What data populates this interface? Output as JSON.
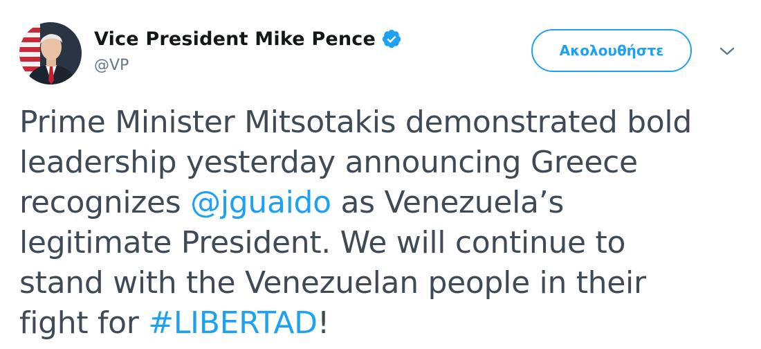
{
  "author": {
    "display_name": "Vice President Mike Pence",
    "handle": "@VP",
    "verified": true,
    "avatar_icon": "profile-photo"
  },
  "actions": {
    "follow_label": "Ακολουθήστε",
    "menu_icon": "chevron-down-icon"
  },
  "colors": {
    "accent": "#1da1f2",
    "text": "#3f4a55",
    "name": "#14171a",
    "handle": "#657786"
  },
  "tweet": {
    "line1": "Prime Minister Mitsotakis demonstrated bold",
    "line2": "leadership yesterday announcing Greece",
    "line3_before": "recognizes ",
    "mention": "@jguaido",
    "line3_after": " as Venezuela’s",
    "line4": "legitimate President. We will continue to",
    "line5": "stand with the Venezuelan people in their",
    "line6_before": "fight for ",
    "hashtag": "#LIBERTAD",
    "line6_after": "!"
  }
}
